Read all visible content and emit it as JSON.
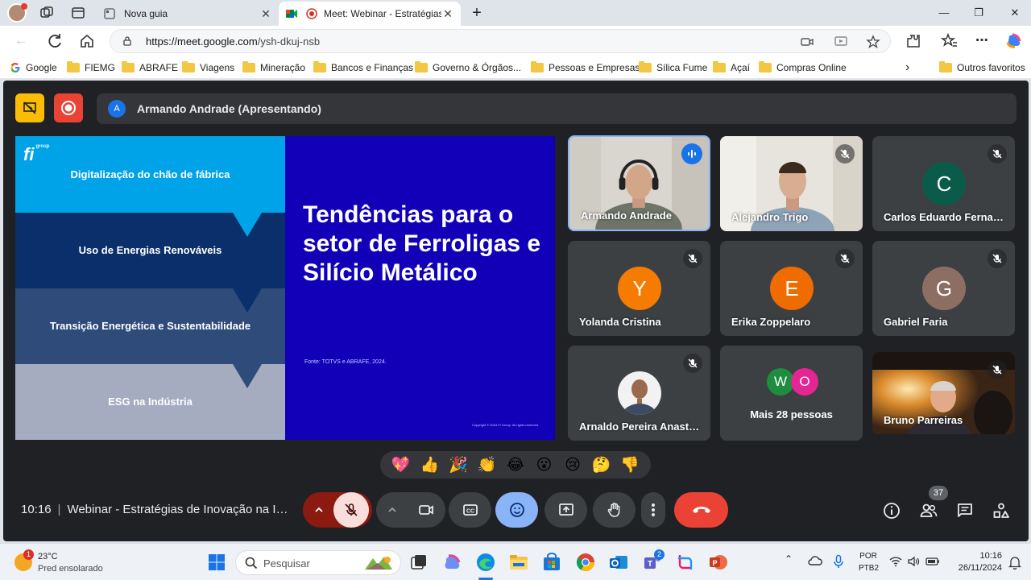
{
  "browser": {
    "tabs": [
      {
        "title": "Nova guia"
      },
      {
        "title": "Meet: Webinar - Estratégias de Inovação"
      }
    ],
    "url_host": "https://meet.google.com",
    "url_path": "/ysh-dkuj-nsb",
    "bookmarks": [
      {
        "label": "Google",
        "type": "google"
      },
      {
        "label": "FIEMG",
        "type": "folder"
      },
      {
        "label": "ABRAFE",
        "type": "folder"
      },
      {
        "label": "Viagens",
        "type": "folder"
      },
      {
        "label": "Mineração",
        "type": "folder"
      },
      {
        "label": "Bancos e Finanças",
        "type": "folder"
      },
      {
        "label": "Governo & Órgãos...",
        "type": "folder"
      },
      {
        "label": "Pessoas e Empresas",
        "type": "folder"
      },
      {
        "label": "Sílica Fume",
        "type": "folder"
      },
      {
        "label": "Açaí",
        "type": "folder"
      },
      {
        "label": "Compras Online",
        "type": "folder"
      }
    ],
    "other_bookmarks": "Outros favoritos",
    "colors": {
      "tab_bg": "#dfe3ea",
      "folder": "#f2c744"
    }
  },
  "meet": {
    "presenter_initial": "A",
    "presenter_label": "Armando Andrade (Apresentando)",
    "slide": {
      "logo": "fi",
      "logo_sub": "group",
      "bands": [
        {
          "text": "Digitalização do chão de fábrica",
          "color": "#00a3e8"
        },
        {
          "text": "Uso de Energias Renováveis",
          "color": "#0a2f6b"
        },
        {
          "text": "Transição Energética e Sustentabilidade",
          "color": "#2f4b79"
        },
        {
          "text": "ESG na Indústria",
          "color": "#a6acc0"
        }
      ],
      "heading": "Tendências para o setor de Ferroligas e Silício Metálico",
      "source": "Fonte: TOTVS e ABRAFE, 2024.",
      "copyright": "Copyright © 2024 Fi Group. All rights reserved."
    },
    "participants": [
      {
        "name": "Armando Andrade",
        "kind": "video",
        "speaking": true
      },
      {
        "name": "Alejandro Trigo",
        "kind": "video",
        "muted": true
      },
      {
        "name": "Carlos Eduardo Fernandes",
        "kind": "avatar",
        "initial": "C",
        "color": "#0b5b4a",
        "muted": true
      },
      {
        "name": "Yolanda Cristina",
        "kind": "avatar",
        "initial": "Y",
        "color": "#f57c00",
        "muted": true
      },
      {
        "name": "Erika Zoppelaro",
        "kind": "avatar",
        "initial": "E",
        "color": "#ef6c00",
        "muted": true
      },
      {
        "name": "Gabriel Faria",
        "kind": "avatar",
        "initial": "G",
        "color": "#8d6e63",
        "muted": true
      },
      {
        "name": "Arnaldo Pereira Anastácio",
        "kind": "photo",
        "muted": true
      },
      {
        "name": "Mais 28 pessoas",
        "kind": "more",
        "initials": [
          "W",
          "O"
        ],
        "colors": [
          "#1e8e3e",
          "#e52592"
        ]
      },
      {
        "name": "Bruno Parreiras",
        "kind": "video",
        "muted": true
      }
    ],
    "reactions": [
      "💖",
      "👍",
      "🎉",
      "👏",
      "😂",
      "😮",
      "😢",
      "🤔",
      "👎"
    ],
    "time": "10:16",
    "meeting_title": "Webinar - Estratégias de Inovação na Indústria",
    "participant_count": "37",
    "colors": {
      "bg": "#202124",
      "tile": "#3c4043",
      "hangup": "#ea4335",
      "accent": "#8ab4f8"
    }
  },
  "taskbar": {
    "temp": "23°C",
    "condition": "Pred ensolarado",
    "weather_alert": "1",
    "search_placeholder": "Pesquisar",
    "teams_badge": "2",
    "lang_1": "POR",
    "lang_2": "PTB2",
    "clock_time": "10:16",
    "clock_date": "26/11/2024"
  }
}
